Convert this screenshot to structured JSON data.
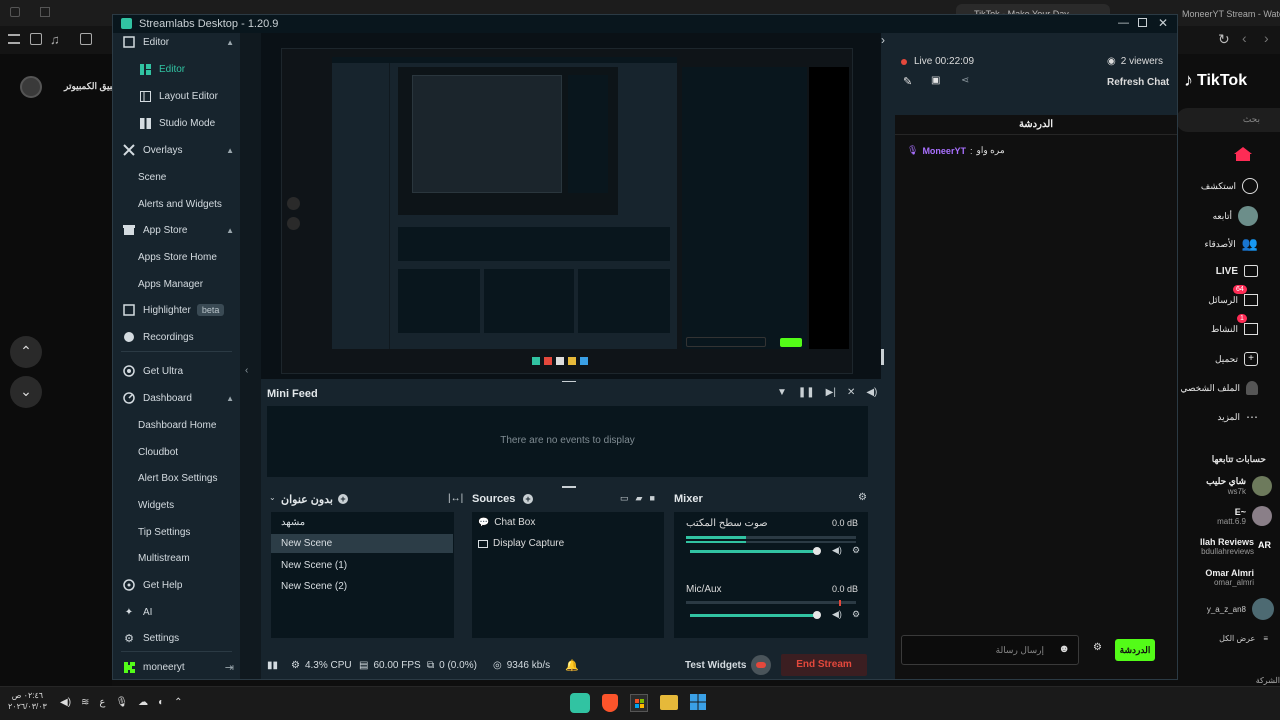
{
  "window": {
    "title": "Streamlabs Desktop - 1.20.9",
    "browser_tab_1": "TikTok - Make Your Day",
    "browser_tab_2": "MoneerYT Stream - Watch Live on Ki"
  },
  "sidebar": {
    "items": [
      {
        "label": "Editor",
        "icon": "editor-icon",
        "level": "group"
      },
      {
        "label": "Editor",
        "icon": "editor-sub-icon",
        "level": "sub",
        "active": true
      },
      {
        "label": "Layout Editor",
        "icon": "layout-icon",
        "level": "sub"
      },
      {
        "label": "Studio Mode",
        "icon": "studio-icon",
        "level": "sub"
      },
      {
        "label": "Overlays",
        "icon": "overlays-icon",
        "level": "group"
      },
      {
        "label": "Scene",
        "level": "sub"
      },
      {
        "label": "Alerts and Widgets",
        "level": "sub"
      },
      {
        "label": "App Store",
        "icon": "store-icon",
        "level": "group"
      },
      {
        "label": "Apps Store Home",
        "level": "sub"
      },
      {
        "label": "Apps Manager",
        "level": "sub"
      },
      {
        "label": "Highlighter",
        "icon": "highlighter-icon",
        "level": "group"
      },
      {
        "label": "Recordings",
        "icon": "recordings-icon",
        "level": "group"
      },
      {
        "label": "Get Ultra",
        "icon": "ultra-icon",
        "level": "group"
      },
      {
        "label": "Dashboard",
        "icon": "dashboard-icon",
        "level": "group"
      },
      {
        "label": "Dashboard Home",
        "level": "sub"
      },
      {
        "label": "Cloudbot",
        "level": "sub"
      },
      {
        "label": "Alert Box Settings",
        "level": "sub"
      },
      {
        "label": "Widgets",
        "level": "sub"
      },
      {
        "label": "Tip Settings",
        "level": "sub"
      },
      {
        "label": "Multistream",
        "level": "sub"
      },
      {
        "label": "Get Help",
        "icon": "help-icon",
        "level": "group"
      },
      {
        "label": "AI",
        "icon": "ai-icon",
        "level": "group"
      },
      {
        "label": "Settings",
        "icon": "settings-icon",
        "level": "group"
      }
    ],
    "beta_label": "beta",
    "username": "moneeryt"
  },
  "mini_feed": {
    "title": "Mini Feed",
    "empty_text": "There are no events to display"
  },
  "scenes": {
    "title": "بدون عنوان",
    "items": [
      "مشهد",
      "New Scene",
      "New Scene (1)",
      "New Scene (2)"
    ],
    "selected": "New Scene"
  },
  "sources": {
    "title": "Sources",
    "items": [
      {
        "label": "Chat Box",
        "icon": "chat-icon"
      },
      {
        "label": "Display Capture",
        "icon": "monitor-icon"
      }
    ]
  },
  "mixer": {
    "title": "Mixer",
    "channels": [
      {
        "name": "صوت سطح المكتب",
        "db": "0.0 dB",
        "level": 0.35,
        "volume": 1.0
      },
      {
        "name": "Mic/Aux",
        "db": "0.0 dB",
        "level": 0.0,
        "volume": 1.0
      }
    ]
  },
  "status": {
    "cpu": "4.3% CPU",
    "fps": "60.00 FPS",
    "dropped": "0 (0.0%)",
    "bitrate": "9346 kb/s",
    "test_widgets": "Test Widgets",
    "end_stream": "End Stream"
  },
  "chat": {
    "live_time": "Live 00:22:09",
    "viewers": "2 viewers",
    "refresh": "Refresh Chat",
    "header": "الدردشة",
    "messages": [
      {
        "user": "MoneerYT",
        "text": "مره واو"
      }
    ],
    "input_placeholder": "إرسال رسالة",
    "send_label": "الدردشة"
  },
  "tiktok": {
    "logo": "TikTok",
    "search_placeholder": "بحث",
    "nav": [
      {
        "label": "استكشف",
        "icon": "compass-icon"
      },
      {
        "label": "أتابعه",
        "icon": "avatar-icon"
      },
      {
        "label": "الأصدقاء",
        "icon": "friends-icon"
      },
      {
        "label": "LIVE",
        "icon": "live-icon"
      },
      {
        "label": "الرسائل",
        "icon": "message-icon",
        "badge": "64"
      },
      {
        "label": "النشاط",
        "icon": "activity-icon",
        "badge": "1"
      },
      {
        "label": "تحميل",
        "icon": "upload-icon"
      },
      {
        "label": "الملف الشخصي",
        "icon": "profile-icon"
      },
      {
        "label": "المزيد",
        "icon": "more-icon"
      }
    ],
    "following_title": "حسابات تتابعها",
    "following": [
      {
        "name": "شاي حليب",
        "handle": "ws7k"
      },
      {
        "name": "E~",
        "handle": "matt.6.9"
      },
      {
        "name": "llah Reviews",
        "handle": "bdullahreviews"
      },
      {
        "name": "Omar Almri",
        "handle": "omar_almri"
      },
      {
        "name": "y_a_z_an8",
        "handle": ""
      }
    ],
    "show_all": "عرض الكل",
    "footer": "الشركة"
  },
  "left_browser": {
    "label": "تطبيق الكمبيوتر"
  },
  "taskbar": {
    "time": "٠٢:٤٦ ص",
    "date": "٢٠٢٦/٠٣/٠٣",
    "lang": "ع"
  },
  "colors": {
    "accent": "#31c3a2",
    "live_red": "#e4483c",
    "chat_green": "#53fc18",
    "tiktok_pink": "#fe2c55"
  }
}
